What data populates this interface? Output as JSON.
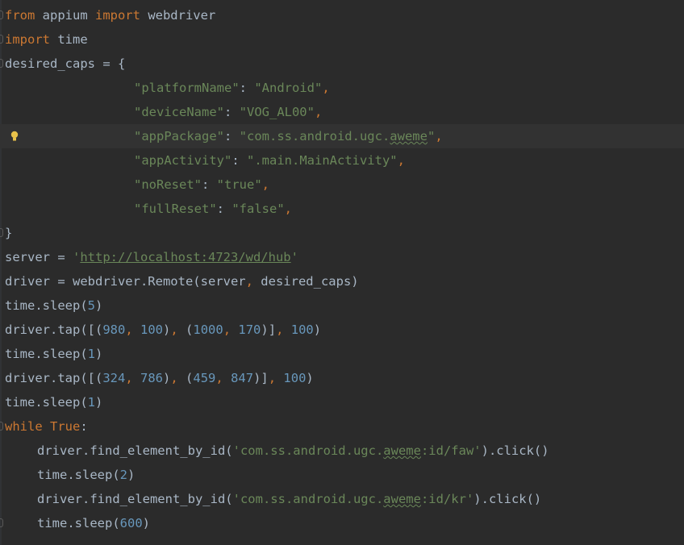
{
  "editor": {
    "lines": [
      {
        "tokens": [
          {
            "t": "from",
            "c": "kw"
          },
          {
            "t": " appium "
          },
          {
            "t": "import",
            "c": "kw"
          },
          {
            "t": " webdriver"
          }
        ],
        "indent": 0,
        "fold": true
      },
      {
        "tokens": [
          {
            "t": "import",
            "c": "kw"
          },
          {
            "t": " time"
          }
        ],
        "indent": 0,
        "fold": true
      },
      {
        "tokens": [
          {
            "t": "desired_caps = {"
          }
        ],
        "indent": 0,
        "fold": true
      },
      {
        "tokens": [
          {
            "t": "\"platformName\"",
            "c": "str"
          },
          {
            "t": ": "
          },
          {
            "t": "\"Android\"",
            "c": "str"
          },
          {
            "t": ",",
            "c": "punct"
          }
        ],
        "indent": 16
      },
      {
        "tokens": [
          {
            "t": "\"deviceName\"",
            "c": "str"
          },
          {
            "t": ": "
          },
          {
            "t": "\"VOG_AL00\"",
            "c": "str"
          },
          {
            "t": ",",
            "c": "punct"
          }
        ],
        "indent": 16
      },
      {
        "tokens": [
          {
            "t": "\"appPackage\"",
            "c": "str"
          },
          {
            "t": ": "
          },
          {
            "t": "\"com.ss.android.ugc.",
            "c": "str"
          },
          {
            "t": "aweme",
            "c": "str typo"
          },
          {
            "t": "\"",
            "c": "str"
          },
          {
            "t": ",",
            "c": "punct"
          }
        ],
        "indent": 16,
        "current": true,
        "bulb": true
      },
      {
        "tokens": [
          {
            "t": "\"appActivity\"",
            "c": "str"
          },
          {
            "t": ": "
          },
          {
            "t": "\".main.MainActivity\"",
            "c": "str"
          },
          {
            "t": ",",
            "c": "punct"
          }
        ],
        "indent": 16
      },
      {
        "tokens": [
          {
            "t": "\"noReset\"",
            "c": "str"
          },
          {
            "t": ": "
          },
          {
            "t": "\"true\"",
            "c": "str"
          },
          {
            "t": ",",
            "c": "punct"
          }
        ],
        "indent": 16
      },
      {
        "tokens": [
          {
            "t": "\"fullReset\"",
            "c": "str"
          },
          {
            "t": ": "
          },
          {
            "t": "\"false\"",
            "c": "str"
          },
          {
            "t": ",",
            "c": "punct"
          }
        ],
        "indent": 16
      },
      {
        "tokens": [
          {
            "t": "}"
          }
        ],
        "indent": 0,
        "fold": true
      },
      {
        "tokens": [
          {
            "t": "server = "
          },
          {
            "t": "'",
            "c": "str"
          },
          {
            "t": "http://localhost:4723/wd/hub",
            "c": "str url"
          },
          {
            "t": "'",
            "c": "str"
          }
        ],
        "indent": 0
      },
      {
        "tokens": [
          {
            "t": "driver = webdriver.Remote(server"
          },
          {
            "t": ",",
            "c": "punct"
          },
          {
            "t": " desired_caps)"
          }
        ],
        "indent": 0
      },
      {
        "tokens": [
          {
            "t": "time.sleep("
          },
          {
            "t": "5",
            "c": "num"
          },
          {
            "t": ")"
          }
        ],
        "indent": 0
      },
      {
        "tokens": [
          {
            "t": "driver.tap([("
          },
          {
            "t": "980",
            "c": "num"
          },
          {
            "t": ",",
            "c": "punct"
          },
          {
            "t": " "
          },
          {
            "t": "100",
            "c": "num"
          },
          {
            "t": ")"
          },
          {
            "t": ",",
            "c": "punct"
          },
          {
            "t": " ("
          },
          {
            "t": "1000",
            "c": "num"
          },
          {
            "t": ",",
            "c": "punct"
          },
          {
            "t": " "
          },
          {
            "t": "170",
            "c": "num"
          },
          {
            "t": ")]"
          },
          {
            "t": ",",
            "c": "punct"
          },
          {
            "t": " "
          },
          {
            "t": "100",
            "c": "num"
          },
          {
            "t": ")"
          }
        ],
        "indent": 0
      },
      {
        "tokens": [
          {
            "t": "time.sleep("
          },
          {
            "t": "1",
            "c": "num"
          },
          {
            "t": ")"
          }
        ],
        "indent": 0
      },
      {
        "tokens": [
          {
            "t": "driver.tap([("
          },
          {
            "t": "324",
            "c": "num"
          },
          {
            "t": ",",
            "c": "punct"
          },
          {
            "t": " "
          },
          {
            "t": "786",
            "c": "num"
          },
          {
            "t": ")"
          },
          {
            "t": ",",
            "c": "punct"
          },
          {
            "t": " ("
          },
          {
            "t": "459",
            "c": "num"
          },
          {
            "t": ",",
            "c": "punct"
          },
          {
            "t": " "
          },
          {
            "t": "847",
            "c": "num"
          },
          {
            "t": ")]"
          },
          {
            "t": ",",
            "c": "punct"
          },
          {
            "t": " "
          },
          {
            "t": "100",
            "c": "num"
          },
          {
            "t": ")"
          }
        ],
        "indent": 0
      },
      {
        "tokens": [
          {
            "t": "time.sleep("
          },
          {
            "t": "1",
            "c": "num"
          },
          {
            "t": ")"
          }
        ],
        "indent": 0
      },
      {
        "tokens": [
          {
            "t": "while",
            "c": "kw"
          },
          {
            "t": " "
          },
          {
            "t": "True",
            "c": "kw"
          },
          {
            "t": ":"
          }
        ],
        "indent": 0,
        "fold": true
      },
      {
        "tokens": [
          {
            "t": "driver.find_element_by_id("
          },
          {
            "t": "'com.ss.android.ugc.",
            "c": "str"
          },
          {
            "t": "aweme",
            "c": "str typo"
          },
          {
            "t": ":id/faw'",
            "c": "str"
          },
          {
            "t": ").click()"
          }
        ],
        "indent": 4
      },
      {
        "tokens": [
          {
            "t": "time.sleep("
          },
          {
            "t": "2",
            "c": "num"
          },
          {
            "t": ")"
          }
        ],
        "indent": 4
      },
      {
        "tokens": [
          {
            "t": "driver.find_element_by_id("
          },
          {
            "t": "'com.ss.android.ugc.",
            "c": "str"
          },
          {
            "t": "aweme",
            "c": "str typo"
          },
          {
            "t": ":id/kr'",
            "c": "str"
          },
          {
            "t": ").click()"
          }
        ],
        "indent": 4
      },
      {
        "tokens": [
          {
            "t": "time.sleep("
          },
          {
            "t": "600",
            "c": "num"
          },
          {
            "t": ")"
          }
        ],
        "indent": 4,
        "fold": true
      }
    ]
  },
  "colors": {
    "background": "#2b2b2b",
    "current_line": "#323232",
    "text": "#a9b7c6",
    "keyword": "#cc7832",
    "string": "#6a8759",
    "number": "#6897bb",
    "bulb": "#e8c14a"
  },
  "icons": [
    "fold-icon",
    "lightbulb-icon"
  ]
}
